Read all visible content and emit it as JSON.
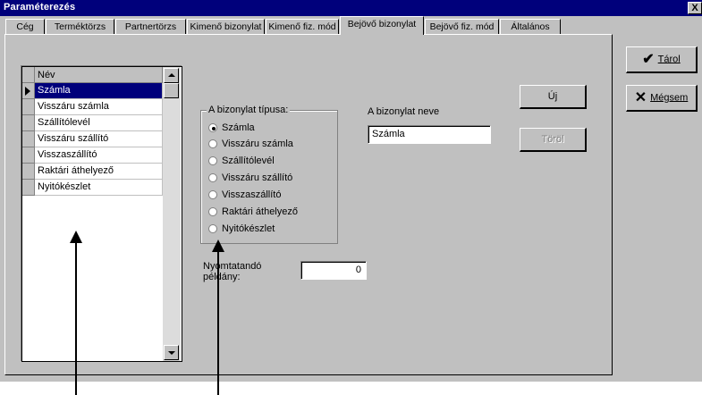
{
  "window": {
    "title": "Paraméterezés",
    "close_label": "X"
  },
  "tabs": [
    {
      "label": "Cég",
      "active": false
    },
    {
      "label": "Terméktörzs",
      "active": false
    },
    {
      "label": "Partnertörzs",
      "active": false
    },
    {
      "label": "Kimenő bizonylat",
      "active": false
    },
    {
      "label": "Kimenő fiz. mód",
      "active": false
    },
    {
      "label": "Bejövő bizonylat",
      "active": true
    },
    {
      "label": "Bejövő fiz. mód",
      "active": false
    },
    {
      "label": "Általános",
      "active": false
    }
  ],
  "list": {
    "header": "Név",
    "items": [
      "Számla",
      "Visszáru számla",
      "Szállítólevél",
      "Visszáru szállító",
      "Visszaszállító",
      "Raktári áthelyező",
      "Nyitókészlet"
    ],
    "selected_index": 0
  },
  "group": {
    "legend": "A bizonylat típusa:",
    "options": [
      "Számla",
      "Visszáru számla",
      "Szállítólevél",
      "Visszáru szállító",
      "Visszaszállító",
      "Raktári áthelyező",
      "Nyitókészlet"
    ],
    "selected_index": 0
  },
  "doc_name": {
    "label": "A bizonylat neve",
    "value": "Számla"
  },
  "copies": {
    "label": "Nyomtatandó példány:",
    "value": "0"
  },
  "buttons": {
    "new": "Új",
    "delete": "Töröl",
    "save": "Tárol",
    "cancel": "Mégsem"
  },
  "icons": {
    "save": "checkmark-icon",
    "cancel": "x-mark-icon"
  }
}
